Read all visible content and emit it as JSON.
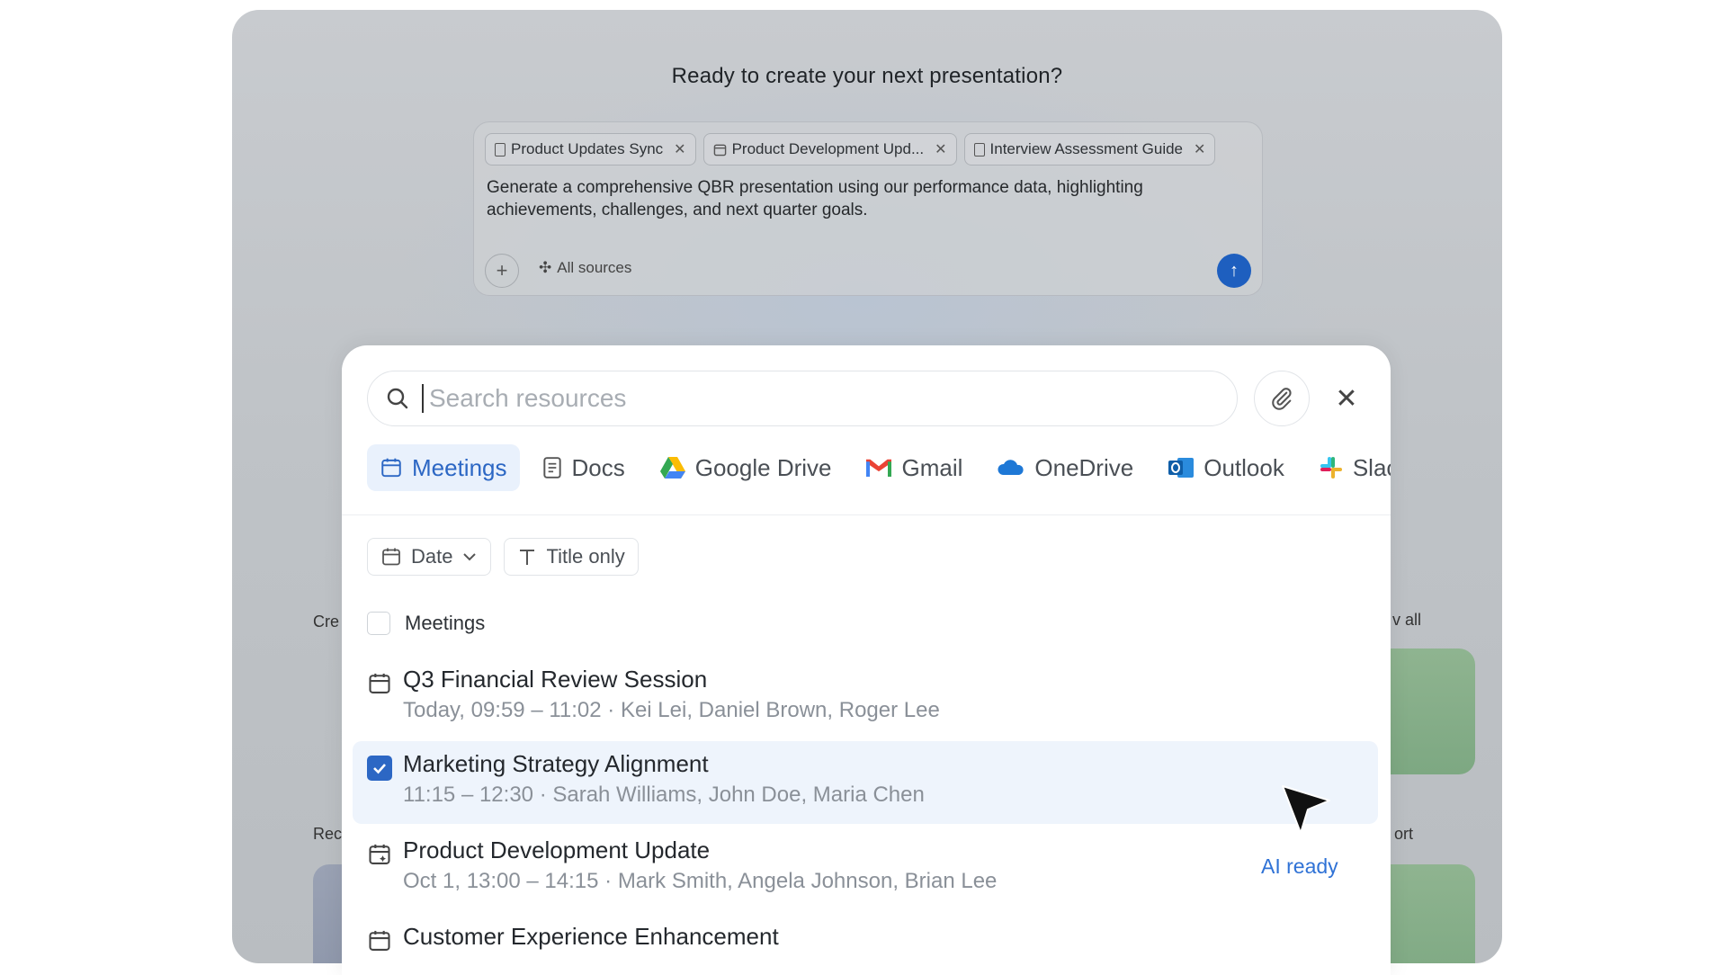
{
  "background": {
    "title": "Ready to create your next presentation?",
    "chips": [
      {
        "label": "Product Updates Sync",
        "icon": "document-icon"
      },
      {
        "label": "Product Development Upd...",
        "icon": "calendar-icon"
      },
      {
        "label": "Interview Assessment Guide",
        "icon": "document-icon"
      }
    ],
    "prompt": "Generate a comprehensive QBR presentation using our performance data, highlighting achievements, challenges, and next quarter goals.",
    "sources_label": "All sources",
    "partial_labels": {
      "left_top": "Cre",
      "left_bottom": "Rec",
      "right_top": "v all",
      "right_bottom": "ort"
    }
  },
  "panel": {
    "search": {
      "placeholder": "Search resources",
      "value": ""
    },
    "tabs": [
      {
        "label": "Meetings",
        "icon": "calendar-icon",
        "active": true
      },
      {
        "label": "Docs",
        "icon": "document-icon",
        "active": false
      },
      {
        "label": "Google Drive",
        "icon": "google-drive-icon",
        "active": false
      },
      {
        "label": "Gmail",
        "icon": "gmail-icon",
        "active": false
      },
      {
        "label": "OneDrive",
        "icon": "onedrive-icon",
        "active": false
      },
      {
        "label": "Outlook",
        "icon": "outlook-icon",
        "active": false
      },
      {
        "label": "Slac",
        "icon": "slack-icon",
        "active": false
      }
    ],
    "filters": {
      "date": "Date",
      "title_only": "Title only"
    },
    "section_label": "Meetings",
    "items": [
      {
        "title": "Q3 Financial Review Session",
        "meta": "Today, 09:59 – 11:02 · Kei Lei, Daniel Brown, Roger Lee",
        "selected": false
      },
      {
        "title": "Marketing Strategy Alignment",
        "meta": "11:15 – 12:30 · Sarah Williams, John Doe, Maria Chen",
        "selected": true
      },
      {
        "title": "Product Development Update",
        "meta": "Oct 1, 13:00 – 14:15 · Mark Smith, Angela Johnson, Brian Lee",
        "selected": false
      },
      {
        "title": "Customer Experience Enhancement",
        "meta": "",
        "selected": false
      }
    ],
    "ai_ready": "AI ready"
  },
  "colors": {
    "accent": "#2c67c4",
    "send_button": "#1e5fbf",
    "ai_ready": "#2f72d6",
    "selected_row": "#eef4fc"
  }
}
